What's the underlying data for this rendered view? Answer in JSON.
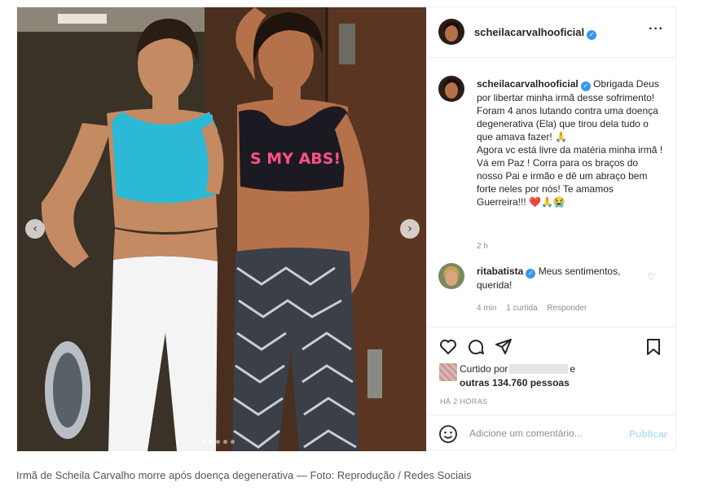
{
  "post": {
    "username": "scheilacarvalhooficial",
    "more_icon": "more-horizontal-icon",
    "image": {
      "shirt_text": "S MY ABS!",
      "alt_icons": {
        "prev": "chevron-left-icon",
        "next": "chevron-right-icon"
      },
      "dots_count": 5,
      "active_dot": 1
    },
    "caption": {
      "username": "scheilacarvalhooficial",
      "text": "Obrigada Deus por libertar minha irmã desse sofrimento! Foram 4 anos lutando contra uma doença degenerativa (Ela) que tirou dela tudo o que amava fazer! 🙏\nAgora vc está livre da matéria minha irmã ! Vá em Paz ! Corra para os braços do nosso Pai e irmão e dê um abraço bem forte neles por nós! Te amamos Guerreira!!! ❤️🙏😭",
      "time": "2 h"
    },
    "comment": {
      "username": "ritabatista",
      "text": "Meus sentimentos, querida!",
      "time": "4 min",
      "likes": "1 curtida",
      "reply": "Responder"
    },
    "likes": {
      "prefix": "Curtido por",
      "suffix": "e",
      "others": "outras 134.760 pessoas"
    },
    "date": "HÁ 2 HORAS",
    "add_comment": {
      "placeholder": "Adicione um comentário...",
      "publish": "Publicar"
    }
  },
  "photo_caption": "Irmã de Scheila Carvalho morre após doença degenerativa — Foto: Reprodução / Redes Sociais",
  "colors": {
    "verified": "#3897f0",
    "accent_blue_light": "#b2dffc",
    "muted_text": "#8e8e8e",
    "text": "#262626",
    "border": "#efefef"
  }
}
